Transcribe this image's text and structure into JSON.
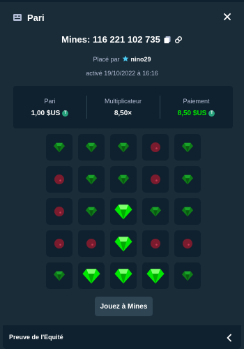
{
  "modal": {
    "title": "Pari",
    "bet_id_label": "Mines: 116 221 102 735",
    "placed_prefix": "Placé par",
    "username": "nino29",
    "activated": "activé 19/10/2022 à 16:16"
  },
  "stats": {
    "bet_label": "Pari",
    "bet_value": "1,00 $US",
    "multiplier_label": "Multiplicateur",
    "multiplier_value": "8,50×",
    "payout_label": "Paiement",
    "payout_value": "8,50 $US",
    "coin_symbol": "T"
  },
  "grid": {
    "rows": [
      [
        "gem",
        "gem",
        "gem",
        "mine",
        "gem"
      ],
      [
        "mine",
        "gem",
        "gem",
        "mine",
        "gem"
      ],
      [
        "mine",
        "gem",
        "gem_revealed",
        "gem",
        "gem"
      ],
      [
        "mine",
        "mine",
        "gem_revealed",
        "mine",
        "mine"
      ],
      [
        "gem",
        "gem_revealed",
        "gem_revealed",
        "gem_revealed",
        "gem"
      ]
    ]
  },
  "play_button": "Jouez à Mines",
  "footer": {
    "label": "Preuve de l'Equité"
  },
  "colors": {
    "background": "#1a2c38",
    "tile": "#0f212e",
    "gem_bright": "#00e701",
    "gem_dim": "#0e7a18",
    "mine": "#7a1b2e",
    "payout_green": "#00e701",
    "text_muted": "#b1bad3"
  },
  "icons": [
    "ticket-icon",
    "close-icon",
    "copy-icon",
    "link-icon",
    "star-badge-icon",
    "tether-coin-icon",
    "gem-icon",
    "mine-icon",
    "chevron-left-icon"
  ]
}
